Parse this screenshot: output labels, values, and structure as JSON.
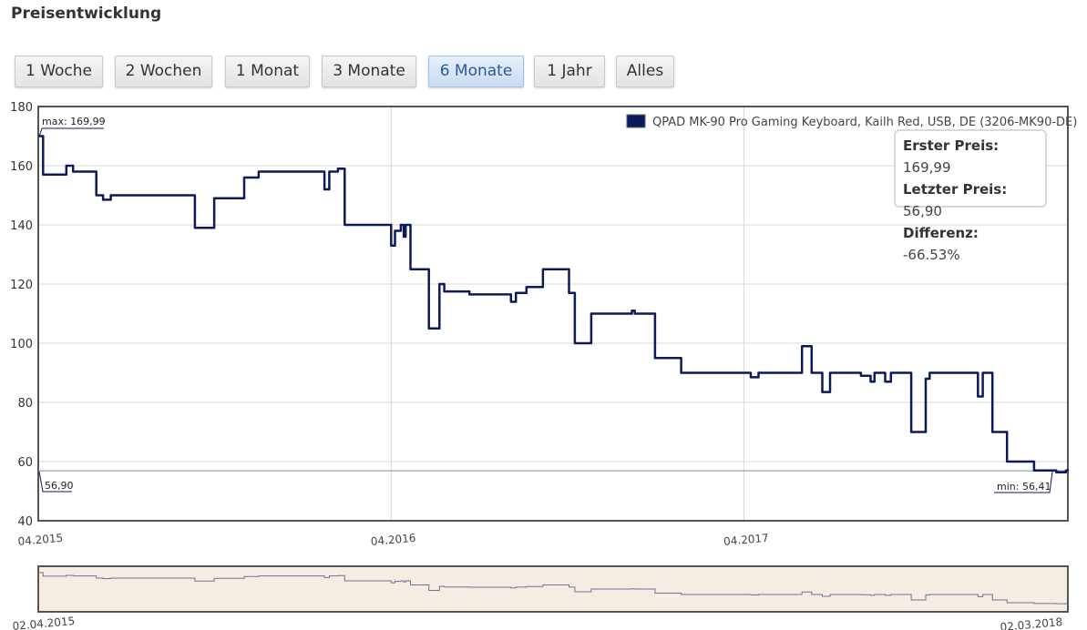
{
  "page": {
    "title": "Preisentwicklung"
  },
  "ranges": [
    {
      "label": "1 Woche",
      "active": false
    },
    {
      "label": "2 Wochen",
      "active": false
    },
    {
      "label": "1 Monat",
      "active": false
    },
    {
      "label": "3 Monate",
      "active": false
    },
    {
      "label": "6 Monate",
      "active": true
    },
    {
      "label": "1 Jahr",
      "active": false
    },
    {
      "label": "Alles",
      "active": false
    }
  ],
  "info": {
    "first_label": "Erster Preis:",
    "first_value": "169,99",
    "last_label": "Letzter Preis:",
    "last_value": "56,90",
    "diff_label": "Differenz:",
    "diff_value": "-66.53%"
  },
  "annotations": {
    "max": "max: 169,99",
    "min": "min: 56,41",
    "current": "56,90"
  },
  "navigator": {
    "start_label": "02.04.2015",
    "end_label": "02.03.2018"
  },
  "colors": {
    "series": "#0b1a5c",
    "navigator_bg": "#f6ede2"
  },
  "chart_data": {
    "type": "line",
    "title": "",
    "xlabel": "",
    "ylabel": "",
    "ylim": [
      40,
      180
    ],
    "yticks": [
      40,
      60,
      80,
      100,
      120,
      140,
      160,
      180
    ],
    "xlim": [
      "2015-04-02",
      "2018-03-02"
    ],
    "xticks": [
      {
        "date": "2015-04-01",
        "label": "04.2015"
      },
      {
        "date": "2016-04-01",
        "label": "04.2016"
      },
      {
        "date": "2017-04-01",
        "label": "04.2017"
      }
    ],
    "grid": true,
    "legend": "top-right",
    "series": [
      {
        "name": "QPAD MK-90 Pro Gaming Keyboard, Kailh Red, USB, DE (3206-MK90-DE)",
        "step": true,
        "points": [
          [
            "2015-04-02",
            169.99
          ],
          [
            "2015-04-07",
            157
          ],
          [
            "2015-05-01",
            160
          ],
          [
            "2015-05-08",
            158
          ],
          [
            "2015-06-01",
            150
          ],
          [
            "2015-06-08",
            148.5
          ],
          [
            "2015-06-16",
            150
          ],
          [
            "2015-09-01",
            150
          ],
          [
            "2015-09-11",
            139
          ],
          [
            "2015-10-01",
            149
          ],
          [
            "2015-11-01",
            156
          ],
          [
            "2015-11-16",
            158
          ],
          [
            "2016-01-23",
            152
          ],
          [
            "2016-01-28",
            158
          ],
          [
            "2016-02-06",
            159
          ],
          [
            "2016-02-13",
            140
          ],
          [
            "2016-04-01",
            133
          ],
          [
            "2016-04-05",
            138
          ],
          [
            "2016-04-11",
            140
          ],
          [
            "2016-04-14",
            136
          ],
          [
            "2016-04-16",
            140
          ],
          [
            "2016-04-21",
            125
          ],
          [
            "2016-05-10",
            105
          ],
          [
            "2016-05-21",
            120
          ],
          [
            "2016-05-26",
            117.5
          ],
          [
            "2016-06-21",
            116.5
          ],
          [
            "2016-08-03",
            114
          ],
          [
            "2016-08-08",
            117
          ],
          [
            "2016-08-19",
            119
          ],
          [
            "2016-09-05",
            125
          ],
          [
            "2016-10-02",
            117
          ],
          [
            "2016-10-08",
            100
          ],
          [
            "2016-10-25",
            110
          ],
          [
            "2016-12-06",
            111
          ],
          [
            "2016-12-09",
            110
          ],
          [
            "2016-12-30",
            95
          ],
          [
            "2017-01-26",
            90
          ],
          [
            "2017-04-08",
            88.5
          ],
          [
            "2017-04-16",
            90
          ],
          [
            "2017-05-31",
            99
          ],
          [
            "2017-06-10",
            90
          ],
          [
            "2017-06-21",
            83.5
          ],
          [
            "2017-06-29",
            90
          ],
          [
            "2017-07-31",
            89
          ],
          [
            "2017-08-10",
            87
          ],
          [
            "2017-08-14",
            90
          ],
          [
            "2017-08-25",
            87
          ],
          [
            "2017-08-31",
            90
          ],
          [
            "2017-09-21",
            70
          ],
          [
            "2017-10-06",
            88
          ],
          [
            "2017-10-10",
            90
          ],
          [
            "2017-11-29",
            82
          ],
          [
            "2017-12-04",
            90
          ],
          [
            "2017-12-14",
            70
          ],
          [
            "2017-12-29",
            60
          ],
          [
            "2018-01-26",
            57
          ],
          [
            "2018-02-18",
            56.41
          ],
          [
            "2018-02-28",
            57
          ],
          [
            "2018-03-02",
            56.9
          ]
        ]
      }
    ]
  }
}
